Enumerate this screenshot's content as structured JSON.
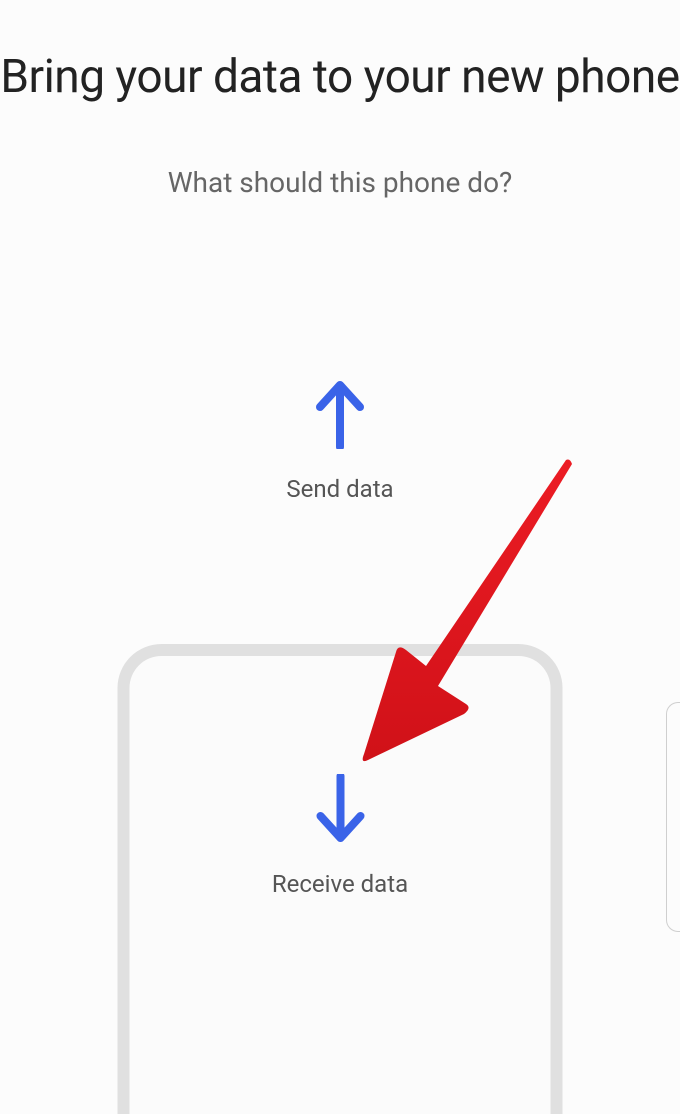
{
  "title": "Bring your data to your new phone",
  "subtitle": "What should this phone do?",
  "options": {
    "send": {
      "label": "Send data"
    },
    "receive": {
      "label": "Receive data"
    }
  },
  "colors": {
    "arrowBlue": "#3a63e8",
    "annotation": "#ec1c24"
  }
}
